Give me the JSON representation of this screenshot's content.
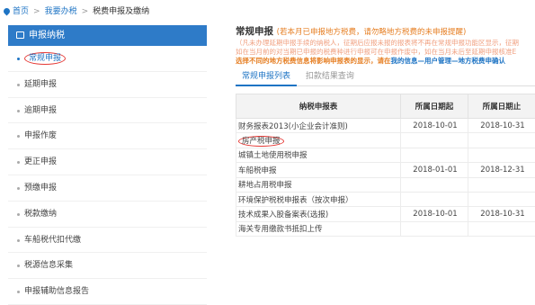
{
  "breadcrumb": {
    "home": "首页",
    "level1": "我要办税",
    "level2": "税费申报及缴纳",
    "sep": ">"
  },
  "sidebar": {
    "header": "申报纳税",
    "items": [
      {
        "label": "常规申报"
      },
      {
        "label": "延期申报"
      },
      {
        "label": "逾期申报"
      },
      {
        "label": "申报作废"
      },
      {
        "label": "更正申报"
      },
      {
        "label": "预缴申报"
      },
      {
        "label": "税款缴纳"
      },
      {
        "label": "车船税代扣代缴"
      },
      {
        "label": "税源信息采集"
      },
      {
        "label": "申报辅助信息报告"
      }
    ]
  },
  "main": {
    "title": "常规申报",
    "title_note": "(若本月已申报地方税费，请勿略地方税费的未申报提醒)",
    "notice_line1": "（凡未办理延期申报手续的纳税人，征期后应报未报的报表将不再在常规申报功能区显示，征期",
    "notice_line2": "如在当月前的对当期已申报的税费种进行申报可在申报作废中，如在当月未后至延期申报核准E",
    "notice_line3_a": "选择不同的地方税费信息将影响申报表的显示，请在",
    "notice_line3_link": "我的信息—用户管理—地方税费申确认",
    "tabs": [
      {
        "label": "常规申报列表"
      },
      {
        "label": "扣款结果查询"
      }
    ],
    "table": {
      "headers": [
        "纳税申报表",
        "所属日期起",
        "所属日期止"
      ],
      "rows": [
        [
          "财务报表2013(小企业会计准则)",
          "2018-10-01",
          "2018-10-31"
        ],
        [
          "房产税申报",
          "",
          ""
        ],
        [
          "城镇土地使用税申报",
          "",
          ""
        ],
        [
          "车船税申报",
          "2018-01-01",
          "2018-12-31"
        ],
        [
          "耕地占用税申报",
          "",
          ""
        ],
        [
          "环境保护税税申报表（按次申报）",
          "",
          ""
        ],
        [
          "技术成果入股备案表(选报)",
          "2018-10-01",
          "2018-10-31"
        ],
        [
          "海关专用缴款书抵扣上传",
          "",
          ""
        ]
      ]
    }
  },
  "colors": {
    "accent": "#1e74c4",
    "header_bg": "#2e7bc8",
    "warning": "#e67e22",
    "highlight_circle": "#e53935"
  }
}
